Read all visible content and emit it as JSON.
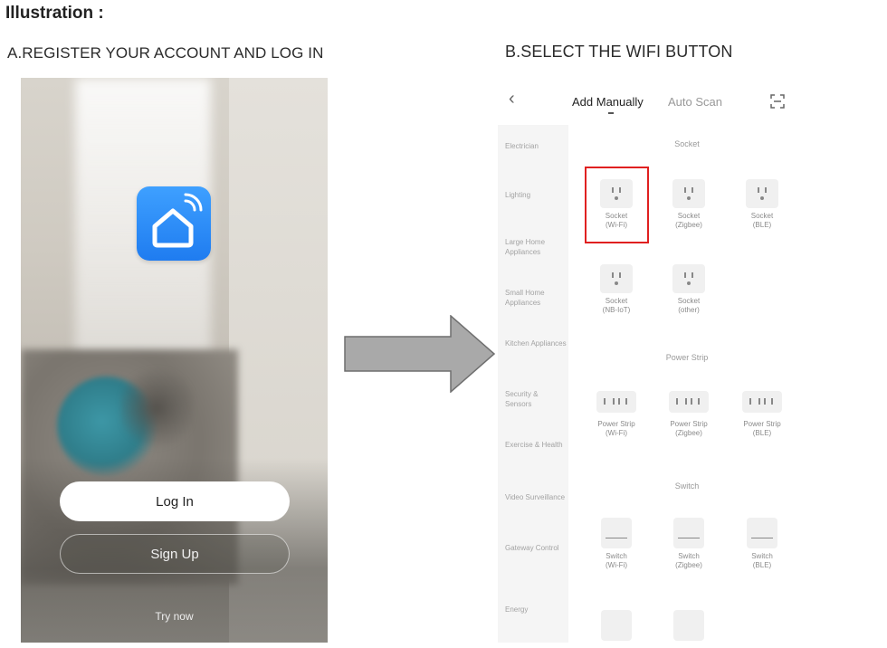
{
  "title": "Illustration :",
  "step_a": {
    "heading": "A.REGISTER YOUR ACCOUNT AND LOG IN",
    "login_label": "Log In",
    "signup_label": "Sign Up",
    "try_label": "Try now",
    "icon": "smart-home-icon",
    "icon_color": "#2b8ef8"
  },
  "step_b": {
    "heading": "B.SELECT THE WIFI BUTTON",
    "tabs": [
      "Add Manually",
      "Auto Scan"
    ],
    "sidebar": [
      "Electrician",
      "Lighting",
      "Large Home Appliances",
      "Small Home Appliances",
      "Kitchen Appliances",
      "Security & Sensors",
      "Exercise & Health",
      "Video Surveillance",
      "Gateway Control",
      "Energy"
    ],
    "sections": [
      "Socket",
      "Power Strip",
      "Switch"
    ],
    "socket_devices": [
      {
        "line1": "Socket",
        "line2": "(Wi-Fi)"
      },
      {
        "line1": "Socket",
        "line2": "(Zigbee)"
      },
      {
        "line1": "Socket",
        "line2": "(BLE)"
      },
      {
        "line1": "Socket",
        "line2": "(NB-IoT)"
      },
      {
        "line1": "Socket",
        "line2": "(other)"
      }
    ],
    "strip_devices": [
      {
        "line1": "Power Strip",
        "line2": "(Wi-Fi)"
      },
      {
        "line1": "Power Strip",
        "line2": "(Zigbee)"
      },
      {
        "line1": "Power Strip",
        "line2": "(BLE)"
      }
    ],
    "switch_devices": [
      {
        "line1": "Switch",
        "line2": "(Wi-Fi)"
      },
      {
        "line1": "Switch",
        "line2": "(Zigbee)"
      },
      {
        "line1": "Switch",
        "line2": "(BLE)"
      }
    ],
    "highlight_color": "#e02020"
  }
}
